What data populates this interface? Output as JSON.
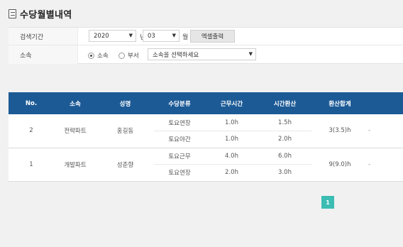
{
  "page": {
    "title": "수당월별내역",
    "icon": "document-list-icon"
  },
  "search": {
    "period_label": "검색기간",
    "year_value": "2020",
    "year_unit": "년",
    "month_value": "03",
    "month_unit": "월",
    "excel_button": "엑셀출력",
    "affiliation_label": "소속",
    "radio_affiliation": "소속",
    "radio_department": "부서",
    "affiliation_select_placeholder": "소속을 선택하세요"
  },
  "table": {
    "headers": [
      "No.",
      "소속",
      "성명",
      "수당분류",
      "근무시간",
      "시간환산",
      "환산합계"
    ],
    "groups": [
      {
        "no": "2",
        "affiliation": "전략파트",
        "name": "홍길동",
        "total": "3(3.5)h",
        "rows": [
          {
            "category": "토요연장",
            "work_hours": "1.0h",
            "converted": "1.5h"
          },
          {
            "category": "토요야간",
            "work_hours": "1.0h",
            "converted": "2.0h"
          }
        ]
      },
      {
        "no": "1",
        "affiliation": "개발파트",
        "name": "성춘향",
        "total": "9(9.0)h",
        "rows": [
          {
            "category": "토요근무",
            "work_hours": "4.0h",
            "converted": "6.0h"
          },
          {
            "category": "토요연장",
            "work_hours": "2.0h",
            "converted": "3.0h"
          }
        ]
      }
    ]
  },
  "pagination": {
    "current": "1"
  },
  "colors": {
    "header_bg": "#1c5a96",
    "pager_bg": "#3bbdb4"
  }
}
